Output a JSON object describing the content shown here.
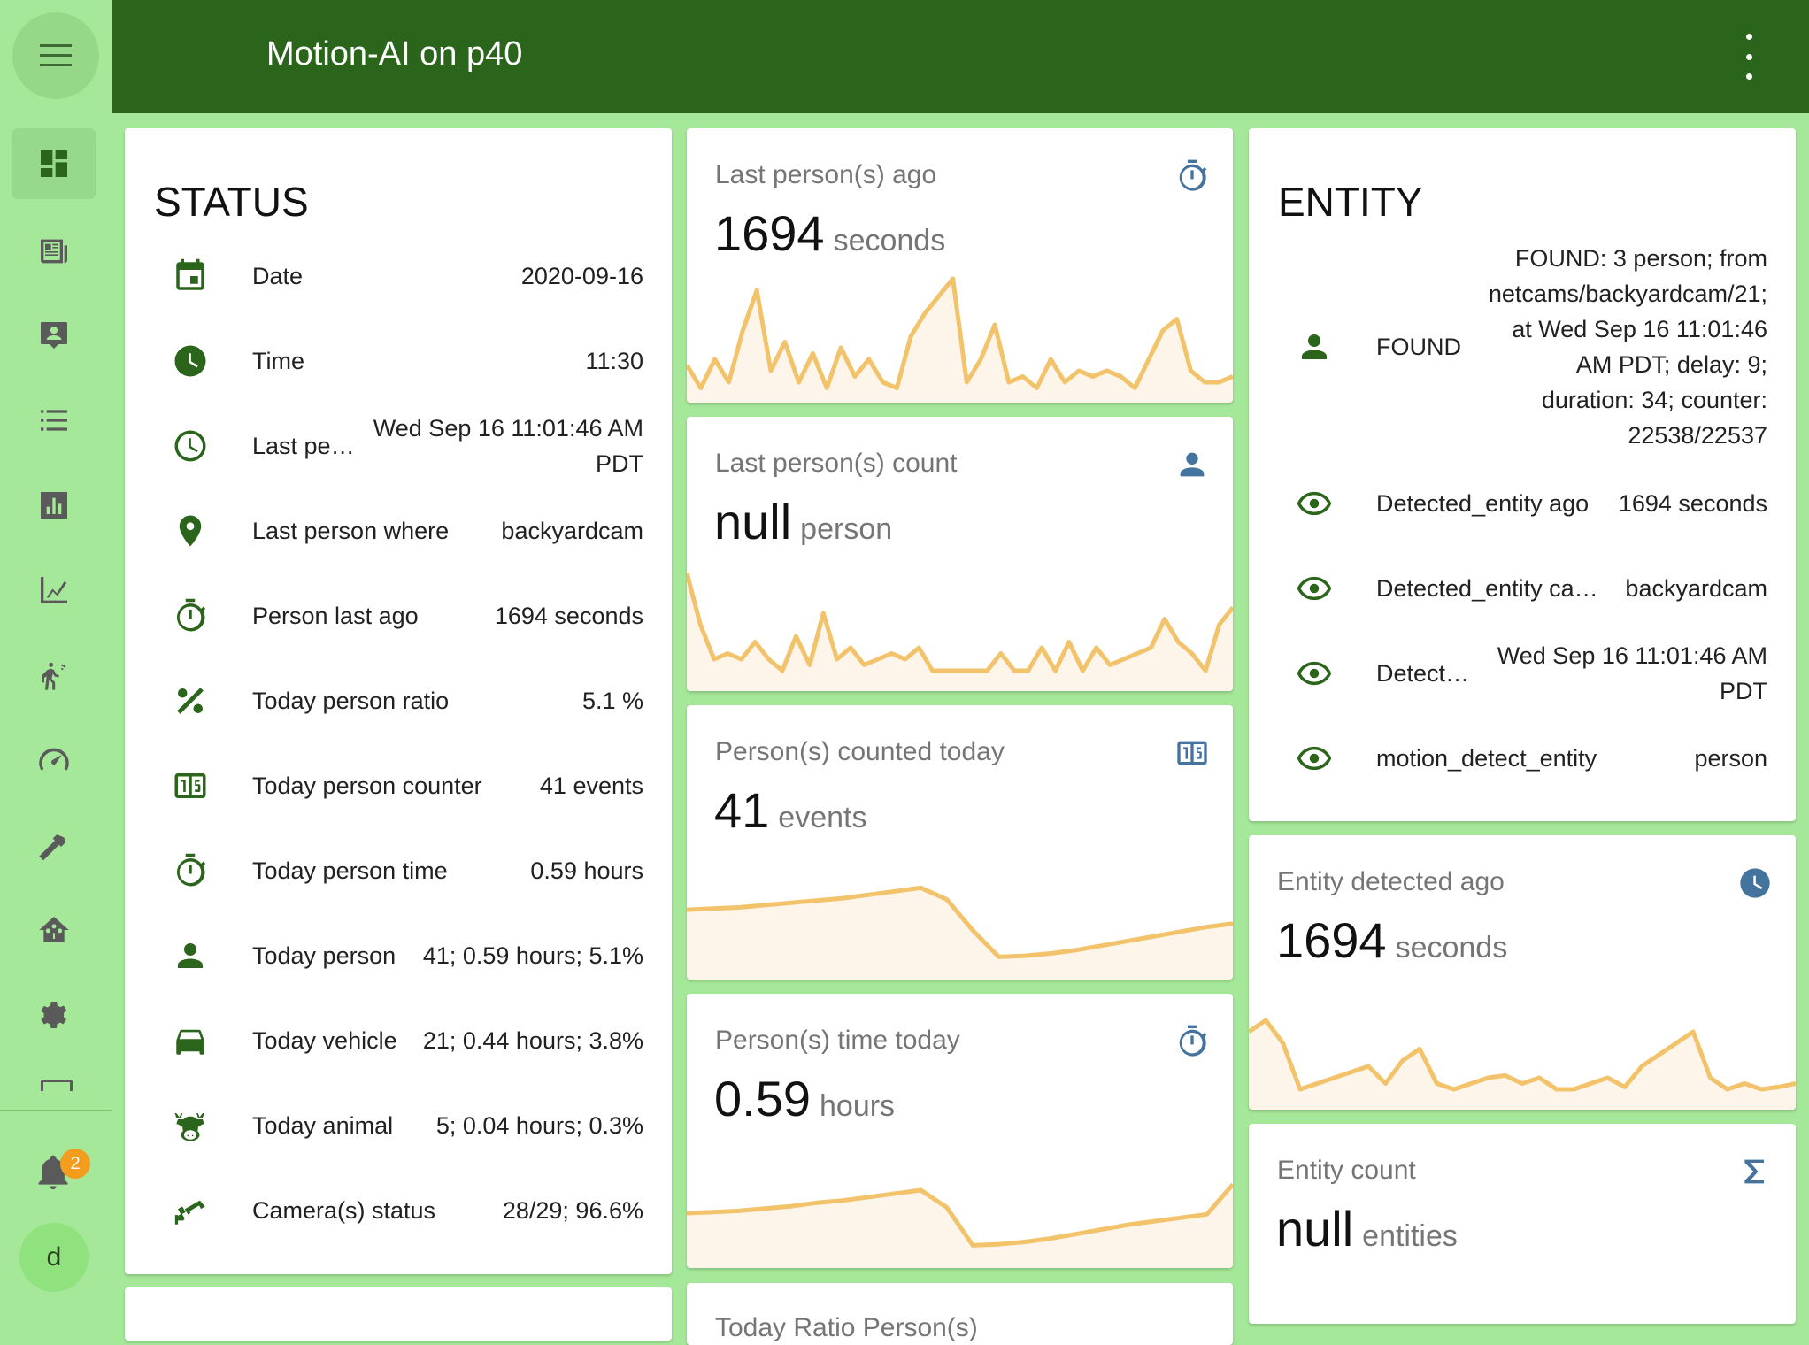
{
  "app": {
    "title": "Motion-AI on p40"
  },
  "sidebar": {
    "items": [
      {
        "icon": "dashboard-icon",
        "active": true
      },
      {
        "icon": "newspaper-icon"
      },
      {
        "icon": "account-box-icon"
      },
      {
        "icon": "list-icon"
      },
      {
        "icon": "bar-chart-icon"
      },
      {
        "icon": "line-chart-icon"
      },
      {
        "icon": "motion-sensor-icon"
      },
      {
        "icon": "speedometer-icon"
      },
      {
        "icon": "hammer-icon"
      },
      {
        "icon": "home-automation-icon"
      },
      {
        "icon": "gear-icon"
      }
    ],
    "notifications_count": "2",
    "user_initial": "d"
  },
  "status": {
    "title": "STATUS",
    "rows": [
      {
        "icon": "calendar-icon",
        "label": "Date",
        "value": "2020-09-16"
      },
      {
        "icon": "clock-filled-icon",
        "label": "Time",
        "value": "11:30"
      },
      {
        "icon": "clock-outline-icon",
        "label": "Last pe…",
        "value": "Wed Sep 16 11:01:46 AM\nPDT"
      },
      {
        "icon": "map-marker-icon",
        "label": "Last person where",
        "value": "backyardcam"
      },
      {
        "icon": "timer-icon",
        "label": "Person last ago",
        "value": "1694 seconds"
      },
      {
        "icon": "percent-icon",
        "label": "Today person ratio",
        "value": "5.1 %"
      },
      {
        "icon": "counter-icon",
        "label": "Today person counter",
        "value": "41 events"
      },
      {
        "icon": "timer-icon",
        "label": "Today person time",
        "value": "0.59 hours"
      },
      {
        "icon": "person-icon",
        "label": "Today person",
        "value": "41; 0.59 hours; 5.1%"
      },
      {
        "icon": "car-icon",
        "label": "Today vehicle",
        "value": "21; 0.44 hours; 3.8%"
      },
      {
        "icon": "cow-icon",
        "label": "Today animal",
        "value": "5; 0.04 hours; 0.3%"
      },
      {
        "icon": "cctv-icon",
        "label": "Camera(s) status",
        "value": "28/29; 96.6%"
      }
    ]
  },
  "sensors": [
    {
      "name": "Last person(s) ago",
      "value": "1694",
      "unit": "seconds",
      "icon": "timer-icon",
      "spark": [
        0.25,
        0.05,
        0.3,
        0.1,
        0.55,
        0.9,
        0.2,
        0.45,
        0.1,
        0.35,
        0.05,
        0.4,
        0.15,
        0.3,
        0.1,
        0.05,
        0.5,
        0.7,
        0.85,
        1.0,
        0.1,
        0.3,
        0.6,
        0.1,
        0.15,
        0.05,
        0.3,
        0.1,
        0.2,
        0.15,
        0.2,
        0.15,
        0.05,
        0.3,
        0.55,
        0.65,
        0.2,
        0.1,
        0.1,
        0.15
      ]
    },
    {
      "name": "Last person(s) count",
      "value": "null",
      "unit": "person",
      "icon": "person-icon",
      "spark": [
        0.95,
        0.5,
        0.2,
        0.25,
        0.2,
        0.35,
        0.2,
        0.1,
        0.4,
        0.15,
        0.6,
        0.2,
        0.3,
        0.15,
        0.2,
        0.25,
        0.2,
        0.3,
        0.1,
        0.1,
        0.1,
        0.1,
        0.1,
        0.25,
        0.1,
        0.1,
        0.3,
        0.1,
        0.35,
        0.1,
        0.3,
        0.15,
        0.2,
        0.25,
        0.3,
        0.55,
        0.35,
        0.25,
        0.1,
        0.5,
        0.65
      ]
    },
    {
      "name": "Person(s) counted today",
      "value": "41",
      "unit": "events",
      "icon": "counter-icon",
      "spark": [
        0.53,
        0.54,
        0.55,
        0.57,
        0.59,
        0.61,
        0.63,
        0.66,
        0.69,
        0.72,
        0.62,
        0.35,
        0.12,
        0.13,
        0.15,
        0.18,
        0.22,
        0.26,
        0.3,
        0.34,
        0.38,
        0.41
      ]
    },
    {
      "name": "Person(s) time today",
      "value": "0.59",
      "unit": "hours",
      "icon": "timer-icon",
      "spark": [
        0.4,
        0.41,
        0.42,
        0.44,
        0.46,
        0.49,
        0.51,
        0.54,
        0.57,
        0.6,
        0.45,
        0.12,
        0.13,
        0.15,
        0.18,
        0.22,
        0.26,
        0.3,
        0.33,
        0.36,
        0.39,
        0.65
      ]
    }
  ],
  "bottom_card_partial": {
    "name": "Today Ratio Person(s)"
  },
  "entity": {
    "title": "ENTITY",
    "rows": [
      {
        "icon": "person-icon",
        "label": "FOUND",
        "value": "FOUND: 3 person; from\nnetcams/backyardcam/21;\nat Wed Sep 16 11:01:46\nAM PDT; delay: 9;\nduration: 34; counter:\n22538/22537"
      },
      {
        "icon": "eye-icon",
        "label": "Detected_entity ago",
        "value": "1694 seconds"
      },
      {
        "icon": "eye-icon",
        "label": "Detected_entity ca…",
        "value": "backyardcam"
      },
      {
        "icon": "eye-icon",
        "label": "Detect…",
        "value": "Wed Sep 16 11:01:46 AM\nPDT"
      },
      {
        "icon": "eye-icon",
        "label": "motion_detect_entity",
        "value": "person"
      }
    ]
  },
  "entity_sensors": [
    {
      "name": "Entity detected ago",
      "value": "1694",
      "unit": "seconds",
      "icon": "clock-filled-icon",
      "spark": [
        0.6,
        0.7,
        0.5,
        0.1,
        0.15,
        0.2,
        0.25,
        0.3,
        0.15,
        0.35,
        0.45,
        0.15,
        0.1,
        0.15,
        0.2,
        0.22,
        0.15,
        0.2,
        0.1,
        0.1,
        0.15,
        0.2,
        0.12,
        0.3,
        0.4,
        0.5,
        0.6,
        0.2,
        0.1,
        0.15,
        0.1,
        0.12,
        0.15
      ]
    },
    {
      "name": "Entity count",
      "value": "null",
      "unit": "entities",
      "icon": "sigma-icon"
    }
  ],
  "colors": {
    "header": "#2b651c",
    "background": "#a6e89a",
    "icon_green": "#2b651c",
    "icon_blue": "#44739e",
    "spark": "#f2c36b",
    "spark_fill": "#fdf5e9",
    "badge": "#f39c1d"
  }
}
